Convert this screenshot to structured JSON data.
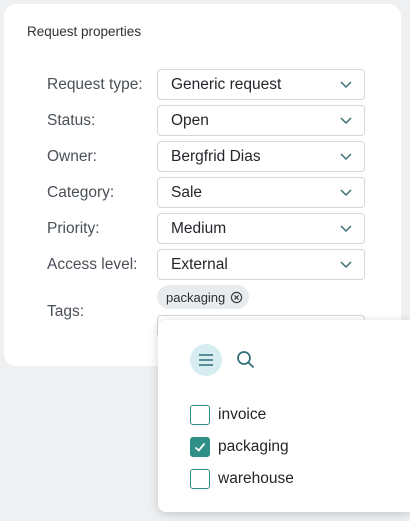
{
  "card": {
    "title": "Request properties"
  },
  "properties": [
    {
      "label": "Request type:",
      "value": "Generic request"
    },
    {
      "label": "Status:",
      "value": "Open"
    },
    {
      "label": "Owner:",
      "value": "Bergfrid Dias"
    },
    {
      "label": "Category:",
      "value": "Sale"
    },
    {
      "label": "Priority:",
      "value": "Medium"
    },
    {
      "label": "Access level:",
      "value": "External"
    }
  ],
  "tags": {
    "label": "Tags:",
    "selected": [
      "packaging"
    ]
  },
  "tag_dropdown": {
    "options": [
      {
        "label": "invoice",
        "checked": false
      },
      {
        "label": "packaging",
        "checked": true
      },
      {
        "label": "warehouse",
        "checked": false
      }
    ]
  },
  "colors": {
    "accent": "#2e8f86",
    "mode_button_bg": "#d6ecf1",
    "chip_bg": "#e8ecef"
  },
  "icons": {
    "select_chevron": "chevron-down-icon",
    "chip_remove": "close-circle-icon",
    "list_mode": "list-icon",
    "search": "search-icon",
    "check": "checkmark-icon"
  }
}
